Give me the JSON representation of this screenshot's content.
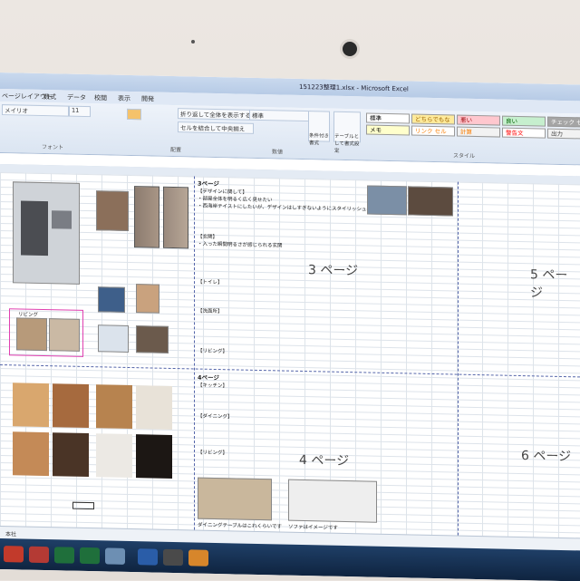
{
  "window": {
    "title": "151223整理1.xlsx - Microsoft Excel"
  },
  "ribbon_tabs": [
    "ページレイアウト",
    "数式",
    "データ",
    "校閲",
    "表示",
    "開発"
  ],
  "ribbon": {
    "font_name": "メイリオ",
    "font_size": "11",
    "wrap_text": "折り返して全体を表示する",
    "merge_center": "セルを結合して中央揃え",
    "number_format": "標準",
    "conditional_format": "条件付き書式",
    "format_as_table": "テーブルとして書式設定",
    "groups": {
      "font": "フォント",
      "alignment": "配置",
      "number": "数値",
      "styles": "スタイル"
    },
    "cell_styles": [
      {
        "label": "標準",
        "bg": "#ffffff",
        "fg": "#000000"
      },
      {
        "label": "どちらでもない",
        "bg": "#ffeb9c",
        "fg": "#9c6500"
      },
      {
        "label": "悪い",
        "bg": "#ffc7ce",
        "fg": "#9c0006"
      },
      {
        "label": "良い",
        "bg": "#c6efce",
        "fg": "#006100"
      },
      {
        "label": "チェック セル",
        "bg": "#a5a5a5",
        "fg": "#ffffff"
      },
      {
        "label": "メモ",
        "bg": "#ffffcc",
        "fg": "#000000"
      },
      {
        "label": "リンク セル",
        "bg": "#ffffff",
        "fg": "#fa7d00"
      },
      {
        "label": "計算",
        "bg": "#f2f2f2",
        "fg": "#fa7d00"
      },
      {
        "label": "警告文",
        "bg": "#ffffff",
        "fg": "#ff0000"
      },
      {
        "label": "出力",
        "bg": "#f2f2f2",
        "fg": "#3f3f3f"
      }
    ]
  },
  "sheet": {
    "page_labels": {
      "p3": "3 ページ",
      "p4": "4 ページ",
      "p5": "5 ページ",
      "p6": "6 ページ"
    },
    "section_page3": "3ページ",
    "section_page4": "4ページ",
    "notes_p3": [
      "【デザインに関して】",
      "・部屋全体を明るく広く見せたい",
      "・西海岸テイストにしたいが、デザインはしすぎないようにスタイリッシュにしたい",
      "【玄関】",
      "・入った瞬間明るさが感じられる玄関",
      "【トイレ】",
      "【洗面所】",
      "【リビング】"
    ],
    "notes_p4": [
      "【キッチン】",
      "【ダイニング】",
      "【リビング】"
    ],
    "captions": {
      "dining": "ダイニングテーブルはこれくらいです",
      "sofa": "ソファはイメージです",
      "living_room": "リビング"
    }
  },
  "sheet_tab": "本社",
  "colors": {
    "excel_blue": "#c9d9ee",
    "grid_line": "#dde3ea",
    "page_break": "#5566aa",
    "selection_pink": "#e040b0",
    "taskbar": "#1f3f67"
  }
}
